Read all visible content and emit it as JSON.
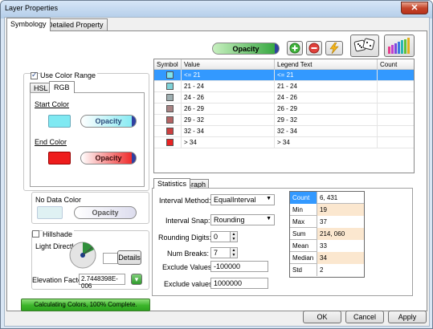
{
  "window": {
    "title": "Layer Properties",
    "close_glyph": "✕"
  },
  "tabs": [
    {
      "label": "Symbology"
    },
    {
      "label": "Detailed Property"
    }
  ],
  "toolbar": {
    "opacity_label": "Opacity",
    "add_icon": "plus-circle-icon",
    "remove_icon": "minus-circle-icon",
    "flip_icon": "lightning-icon",
    "random_icon": "dice-icon",
    "ramp_icon": "color-bars-icon"
  },
  "color_range": {
    "use_label": "Use Color Range",
    "checked": true,
    "tabs": [
      {
        "label": "HSL"
      },
      {
        "label": "RGB"
      }
    ],
    "start_label": "Start Color",
    "start_color": "#7fe9f2",
    "end_label": "End Color",
    "end_color": "#ee1c1c",
    "opacity_label": "Opacity"
  },
  "no_data": {
    "label": "No Data Color",
    "color": "#dff1f3",
    "opacity_label": "Opacity"
  },
  "hillshade": {
    "label": "Hillshade",
    "checked": false,
    "light_label": "Light Directk",
    "details_label": "Details",
    "elevation_label": "Elevation Factor",
    "elevation_value": "2.7448398E-006"
  },
  "progress": {
    "text": "Calculating Colors, 100% Complete.",
    "fraction": 1.0
  },
  "grid": {
    "columns": [
      "Symbol",
      "Value",
      "Legend Text",
      "Count"
    ],
    "rows": [
      {
        "color": "#7fe3ec",
        "value": "<= 21",
        "legend": "<= 21",
        "count": "",
        "selected": true
      },
      {
        "color": "#7fd2d8",
        "value": "21 - 24",
        "legend": "21 - 24",
        "count": "",
        "selected": false
      },
      {
        "color": "#9fb0b2",
        "value": "24 - 26",
        "legend": "24 - 26",
        "count": "",
        "selected": false
      },
      {
        "color": "#a88383",
        "value": "26 - 29",
        "legend": "26 - 29",
        "count": "",
        "selected": false
      },
      {
        "color": "#b46464",
        "value": "29 - 32",
        "legend": "29 - 32",
        "count": "",
        "selected": false
      },
      {
        "color": "#cc4040",
        "value": "32 - 34",
        "legend": "32 - 34",
        "count": "",
        "selected": false
      },
      {
        "color": "#e82222",
        "value": "> 34",
        "legend": "> 34",
        "count": "",
        "selected": false
      }
    ]
  },
  "stats_tabs": [
    {
      "label": "Statistics"
    },
    {
      "label": "Graph"
    }
  ],
  "classify": {
    "interval_method_label": "Interval Method:",
    "interval_method": "EqualInterval",
    "interval_snap_label": "Interval Snap:",
    "interval_snap": "Rounding",
    "rounding_digits_label": "Rounding Digits:",
    "rounding_digits": "0",
    "num_breaks_label": "Num Breaks:",
    "num_breaks": "7",
    "exclude_lt_label": "Exclude Values <",
    "exclude_lt": "-100000",
    "exclude_gt_label": "Exclude values >",
    "exclude_gt": "1000000"
  },
  "stats": [
    {
      "key": "Count",
      "value": "6, 431"
    },
    {
      "key": "Min",
      "value": "19"
    },
    {
      "key": "Max",
      "value": "37"
    },
    {
      "key": "Sum",
      "value": "214, 060"
    },
    {
      "key": "Mean",
      "value": "33"
    },
    {
      "key": "Median",
      "value": "34"
    },
    {
      "key": "Std",
      "value": "2"
    }
  ],
  "buttons": {
    "ok": "OK",
    "cancel": "Cancel",
    "apply": "Apply"
  }
}
